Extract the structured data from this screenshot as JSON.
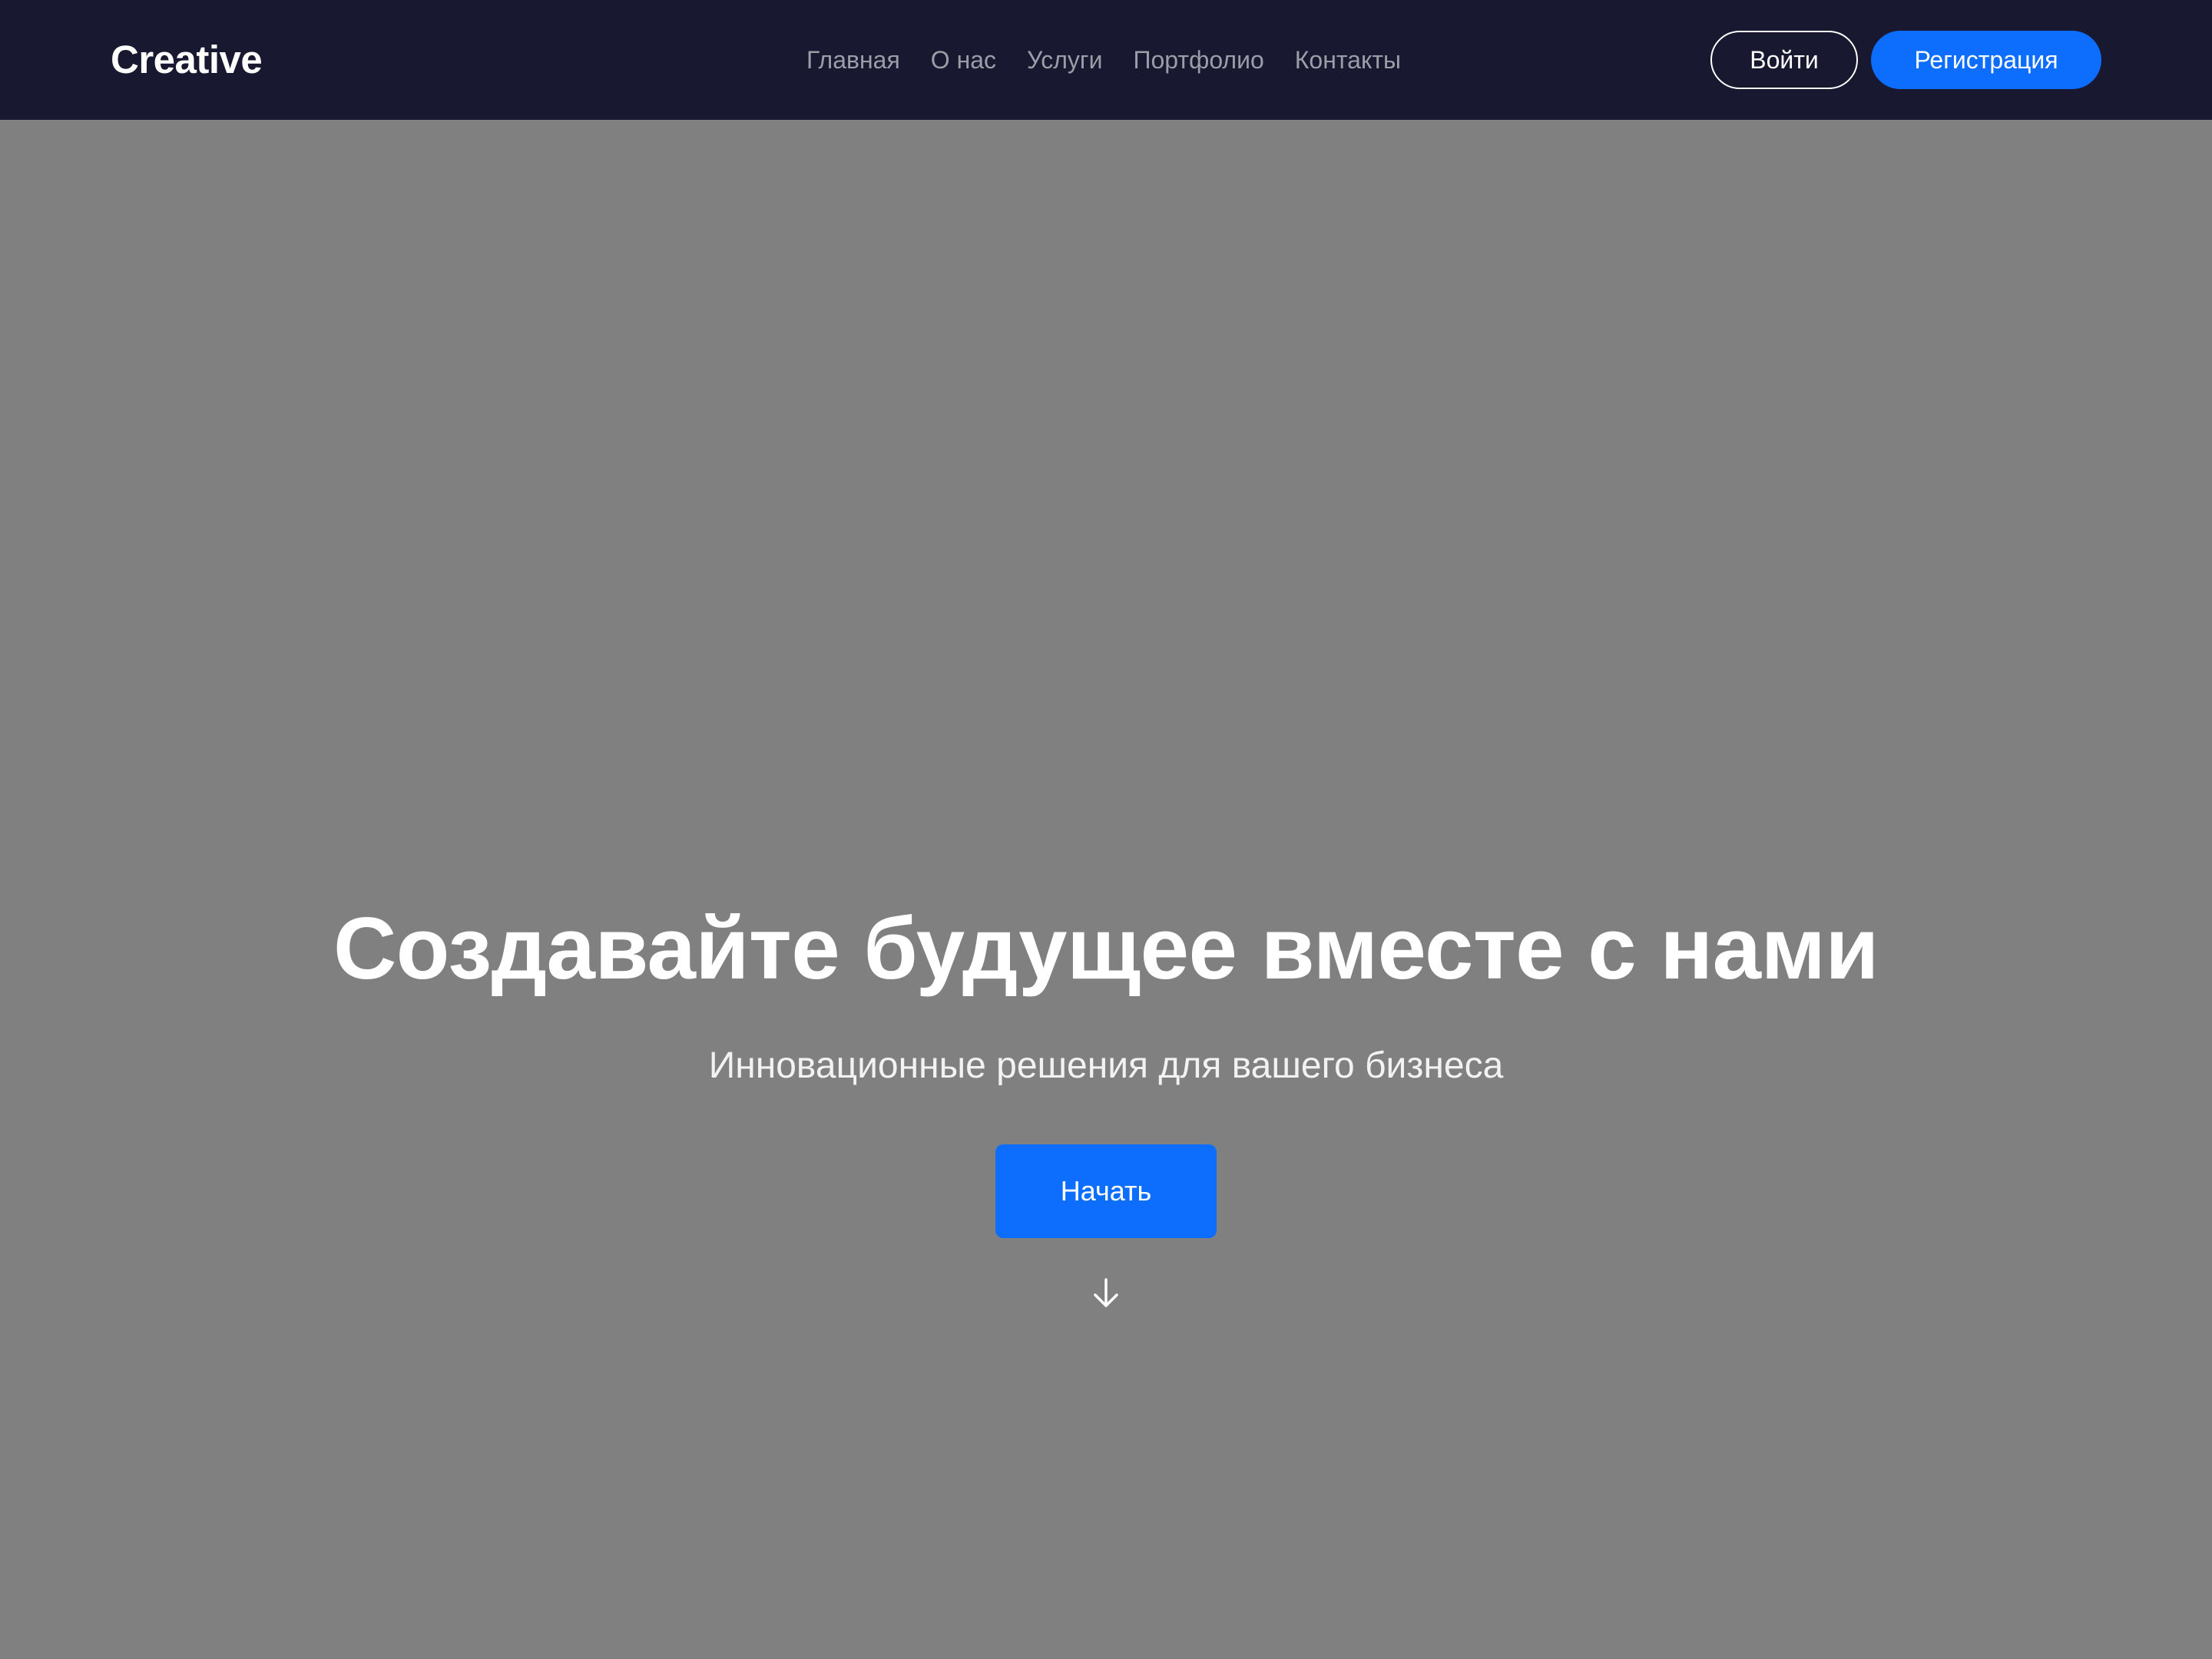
{
  "brand": {
    "logo_text": "Creative"
  },
  "nav": {
    "links": [
      "Главная",
      "О нас",
      "Услуги",
      "Портфолио",
      "Контакты"
    ],
    "login_label": "Войти",
    "register_label": "Регистрация"
  },
  "hero": {
    "title": "Создавайте будущее вместе с нами",
    "subtitle": "Инновационные решения для вашего бизнеса",
    "cta_label": "Начать",
    "scroll_icon": "arrow-down-icon"
  },
  "colors": {
    "navbar_bg": "#181830",
    "hero_bg": "#808080",
    "accent": "#0d6efd",
    "nav_link": "#9d9da8",
    "text_light": "#ffffff"
  }
}
